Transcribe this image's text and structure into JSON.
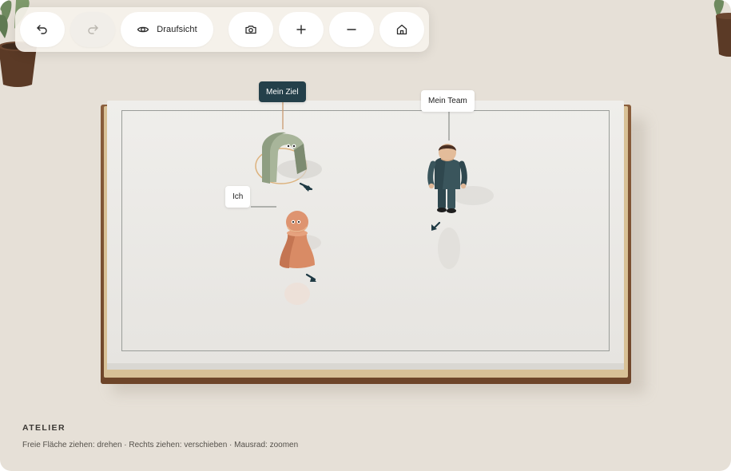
{
  "toolbar": {
    "undo_icon": "undo-icon",
    "redo_icon": "redo-icon",
    "view_label": "Draufsicht",
    "view_icon": "eye-icon",
    "camera_icon": "camera-icon",
    "zoom_in_icon": "plus-icon",
    "zoom_out_icon": "minus-icon",
    "home_icon": "home-icon"
  },
  "scene": {
    "labels": {
      "goal": "Mein Ziel",
      "me": "Ich",
      "team": "Mein Team"
    },
    "figures": [
      "goal-arch",
      "me-pawn",
      "team-person"
    ]
  },
  "footer": {
    "title": "ATELIER",
    "hint": "Freie Fläche ziehen: drehen · Rechts ziehen: verschieben · Mausrad: zoomen"
  },
  "colors": {
    "background": "#e6e0d7",
    "label_dark": "#24404a",
    "goal_figure": "#a8b59a",
    "me_figure": "#d98b65",
    "team_figure": "#3a555c",
    "board_wood": "#7a4f31"
  }
}
